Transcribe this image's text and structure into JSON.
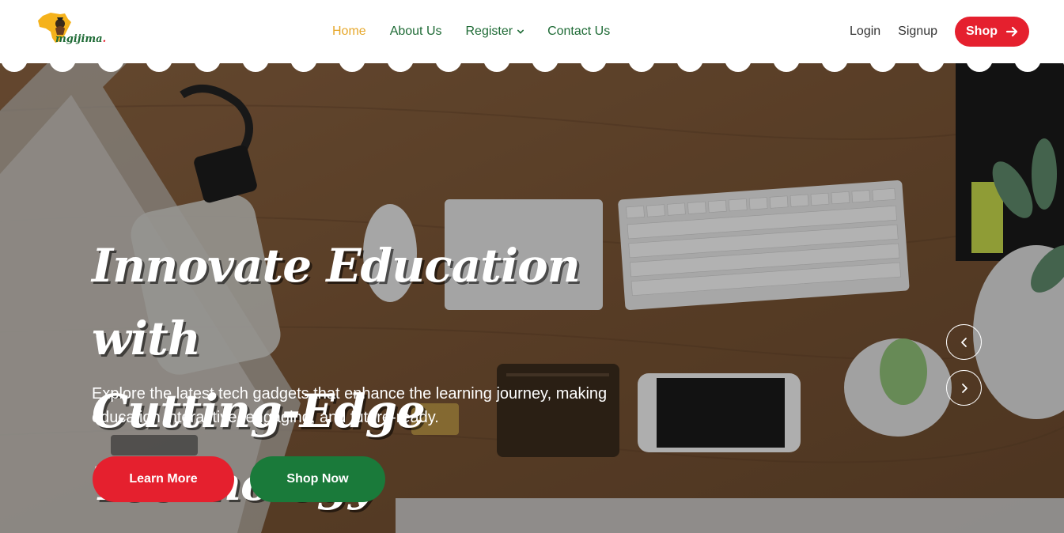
{
  "brand": {
    "name": "mgijima",
    "dot": "."
  },
  "nav": {
    "home": "Home",
    "about": "About Us",
    "register": "Register",
    "contact": "Contact Us"
  },
  "auth": {
    "login": "Login",
    "signup": "Signup",
    "shop": "Shop"
  },
  "hero": {
    "headline_line1": "Innovate Education with",
    "headline_line2": "Cutting-Edge Technology",
    "subtext_line1": "Explore the latest tech gadgets that enhance the learning journey, making",
    "subtext_line2": "education interactive, engaging, and future-ready.",
    "learn_more": "Learn More",
    "shop_now": "Shop Now"
  },
  "icons": {
    "shop": "arrow-right-icon",
    "register": "chevron-down-icon",
    "prev": "chevron-left-icon",
    "next": "chevron-right-icon"
  },
  "colors": {
    "brand_red": "#e5202e",
    "brand_green": "#1f6b36",
    "active_nav": "#e6a72a",
    "shop_now_green": "#1a7a3a"
  }
}
